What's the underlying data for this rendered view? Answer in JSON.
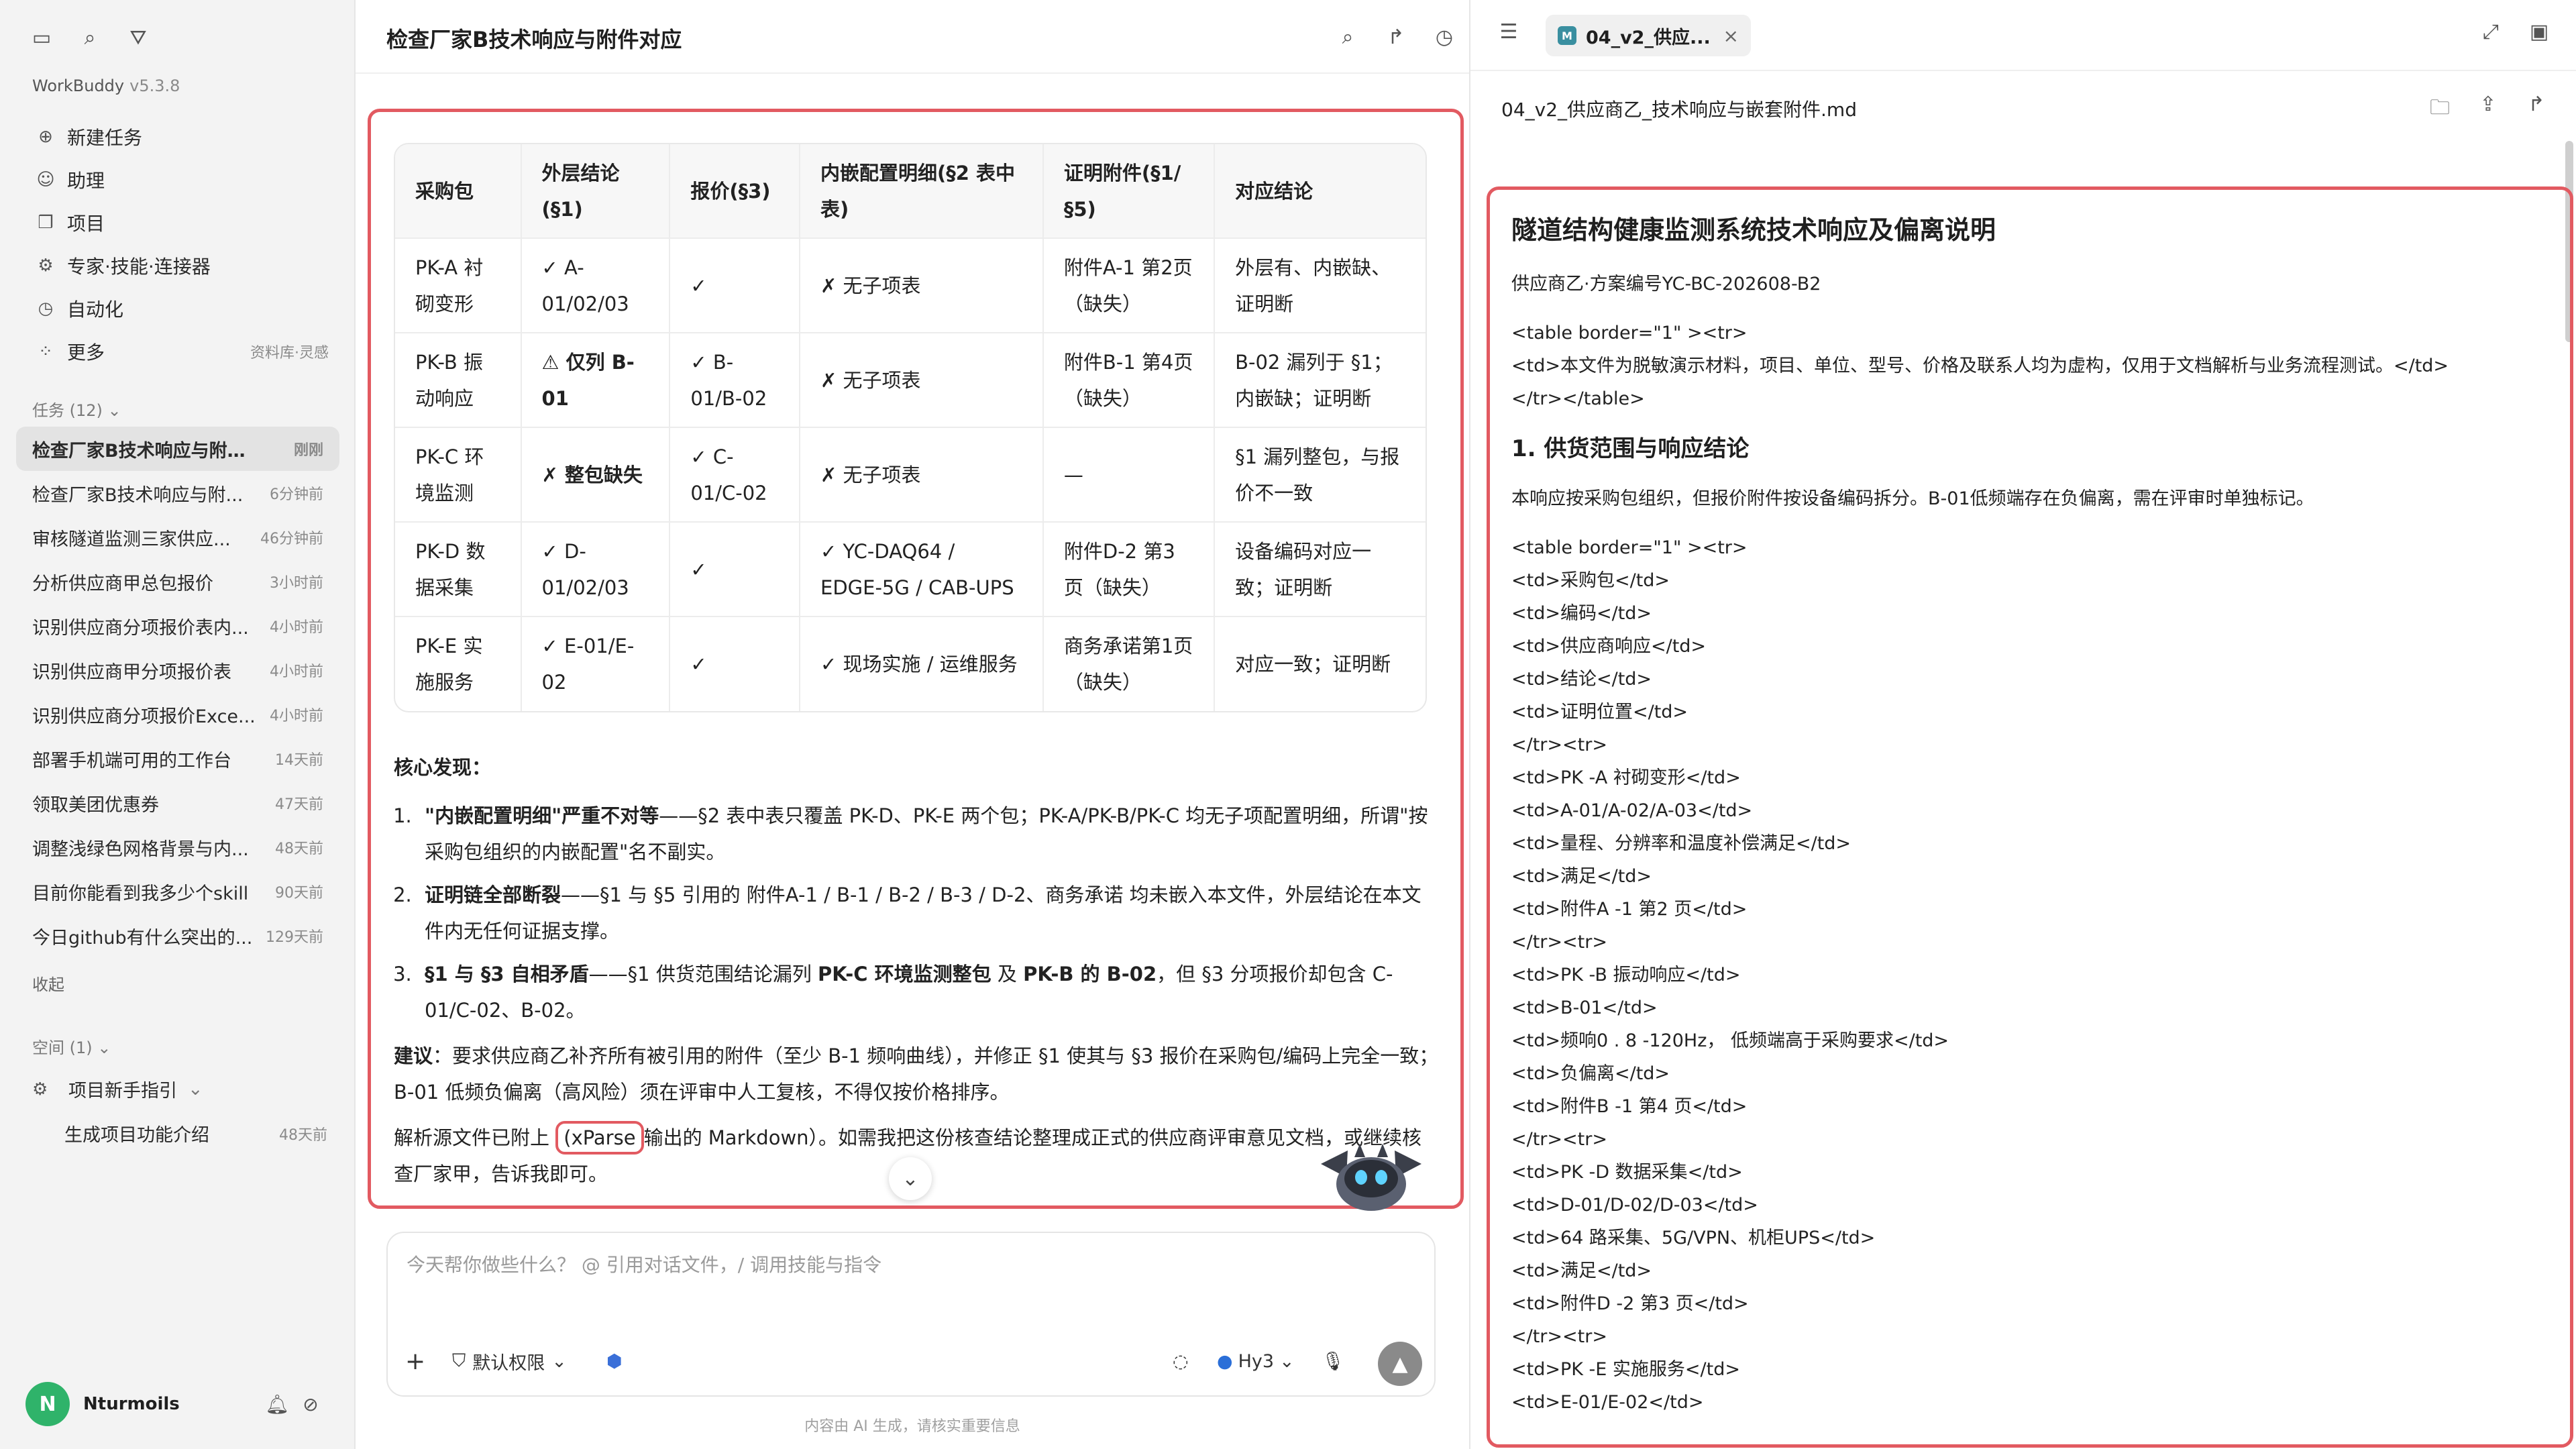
{
  "sidebar": {
    "app_name": "WorkBuddy",
    "version": "v5.3.8",
    "nav": [
      {
        "label": "新建任务",
        "icon": "new-task-icon"
      },
      {
        "label": "助理",
        "icon": "assistant-icon"
      },
      {
        "label": "项目",
        "icon": "project-icon"
      },
      {
        "label": "专家·技能·连接器",
        "icon": "expert-icon"
      },
      {
        "label": "自动化",
        "icon": "automation-icon"
      },
      {
        "label": "更多",
        "icon": "more-icon",
        "aside": "资料库·灵感"
      }
    ],
    "tasks_header": "任务 (12)",
    "tasks": [
      {
        "title": "检查厂家B技术响应与附件...",
        "time": "刚刚"
      },
      {
        "title": "检查厂家B技术响应与附...",
        "time": "6分钟前"
      },
      {
        "title": "审核隧道监测三家供应...",
        "time": "46分钟前"
      },
      {
        "title": "分析供应商甲总包报价",
        "time": "3小时前"
      },
      {
        "title": "识别供应商分项报价表内...",
        "time": "4小时前"
      },
      {
        "title": "识别供应商甲分项报价表",
        "time": "4小时前"
      },
      {
        "title": "识别供应商分项报价Exce...",
        "time": "4小时前"
      },
      {
        "title": "部署手机端可用的工作台",
        "time": "14天前"
      },
      {
        "title": "领取美团优惠券",
        "time": "47天前"
      },
      {
        "title": "调整浅绿色网格背景与内...",
        "time": "48天前"
      },
      {
        "title": "目前你能看到我多少个skill",
        "time": "90天前"
      },
      {
        "title": "今日github有什么突出的...",
        "time": "129天前"
      }
    ],
    "collapse_label": "收起",
    "space_header": "空间 (1)",
    "space_item": "项目新手指引",
    "space_sub": {
      "title": "生成项目功能介绍",
      "time": "48天前"
    },
    "user_name": "Nturmoils",
    "avatar_letter": "N"
  },
  "chat": {
    "title": "检查厂家B技术响应与附件对应",
    "cut_line": "一、一一一一一一一一一一一一一一一一",
    "table": {
      "headers": [
        "采购包",
        "外层结论(§1)",
        "报价(§3)",
        "内嵌配置明细(§2 表中表)",
        "证明附件(§1/§5)",
        "对应结论"
      ],
      "rows": [
        [
          "PK-A 衬砌变形",
          "✓ A-01/02/03",
          "✓",
          "✗ 无子项表",
          "附件A-1 第2页（缺失）",
          "外层有、内嵌缺、证明断"
        ],
        [
          "PK-B 振动响应",
          "⚠ 仅列 B-01",
          "✓ B-01/B-02",
          "✗ 无子项表",
          "附件B-1 第4页（缺失）",
          "B-02 漏列于 §1；内嵌缺；证明断"
        ],
        [
          "PK-C 环境监测",
          "✗ 整包缺失",
          "✓ C-01/C-02",
          "✗ 无子项表",
          "—",
          "§1 漏列整包，与报价不一致"
        ],
        [
          "PK-D 数据采集",
          "✓ D-01/02/03",
          "✓",
          "✓ YC-DAQ64 / EDGE-5G / CAB-UPS",
          "附件D-2 第3页（缺失）",
          "设备编码对应一致；证明断"
        ],
        [
          "PK-E 实施服务",
          "✓ E-01/E-02",
          "✓",
          "✓ 现场实施 / 运维服务",
          "商务承诺第1页（缺失）",
          "对应一致；证明断"
        ]
      ]
    },
    "findings_header": "核心发现：",
    "findings": [
      {
        "bold": "\"内嵌配置明细\"严重不对等",
        "text": "——§2 表中表只覆盖 PK-D、PK-E 两个包；PK-A/PK-B/PK-C 均无子项配置明细，所谓\"按采购包组织的内嵌配置\"名不副实。"
      },
      {
        "bold": "证明链全部断裂",
        "text": "——§1 与 §5 引用的 附件A-1 / B-1 / B-2 / B-3 / D-2、商务承诺 均未嵌入本文件，外层结论在本文件内无任何证据支撑。"
      },
      {
        "bold": "§1 与 §3 自相矛盾",
        "text1": "——§1 供货范围结论漏列 ",
        "bold2": "PK-C 环境监测整包",
        "text2": " 及 ",
        "bold3": "PK-B 的 B-02",
        "text3": "，但 §3 分项报价却包含 C-01/C-02、B-02。"
      }
    ],
    "suggestion_label": "建议",
    "suggestion_text": "：要求供应商乙补齐所有被引用的附件（至少 B-1 频响曲线），并修正 §1 使其与 §3 报价在采购包/编码上完全一致；B-01 低频负偏离（高风险）须在评审中人工复核，不得仅按价格排序。",
    "parse_prefix": "解析源文件已附上",
    "parse_highlight": "xParse",
    "parse_suffix": "输出的 Markdown）。如需我把这份核查结论整理成正式的供应商评审意见文档，或继续核查厂家甲，告诉我即可。",
    "composer_placeholder": "今天帮你做些什么？ @ 引用对话文件，/ 调用技能与指令",
    "permission_label": "默认权限",
    "model_label": "Hy3",
    "disclaimer": "内容由 AI 生成，请核实重要信息"
  },
  "doc": {
    "tab_label": "04_v2_供应...",
    "file_name": "04_v2_供应商乙_技术响应与嵌套附件.md",
    "title": "隧道结构健康监测系统技术响应及偏离说明",
    "subtitle": "供应商乙·方案编号YC-BC-202608-B2",
    "table1_lines": [
      "<table border=\"1\" ><tr>",
      "<td>本文件为脱敏演示材料，项目、单位、型号、价格及联系人均为虚构，仅用于文档解析与业务流程测试。</td>",
      "</tr></table>"
    ],
    "section1": "1.  供货范围与响应结论",
    "section1_para": "本响应按采购包组织，但报价附件按设备编码拆分。B-01低频端存在负偏离，需在评审时单独标记。",
    "table2_lines": [
      "<table border=\"1\" ><tr>",
      "<td>采购包</td>",
      "<td>编码</td>",
      "<td>供应商响应</td>",
      "<td>结论</td>",
      "<td>证明位置</td>",
      "</tr><tr>",
      "<td>PK -A 衬砌变形</td>",
      "<td>A-01/A-02/A-03</td>",
      "<td>量程、分辨率和温度补偿满足</td>",
      "<td>满足</td>",
      "<td>附件A -1 第2 页</td>",
      "</tr><tr>",
      "<td>PK -B  振动响应</td>",
      "<td>B-01</td>",
      "<td>频响0 . 8 -120Hz， 低频端高于采购要求</td>",
      "<td>负偏离</td>",
      "<td>附件B -1 第4 页</td>",
      "</tr><tr>",
      "<td>PK -D 数据采集</td>",
      "<td>D-01/D-02/D-03</td>",
      "<td>64 路采集、5G/VPN、机柜UPS</td>",
      "<td>满足</td>",
      "<td>附件D -2 第3 页</td>",
      "</tr><tr>",
      "<td>PK -E  实施服务</td>",
      "<td>E-01/E-02</td>"
    ]
  }
}
